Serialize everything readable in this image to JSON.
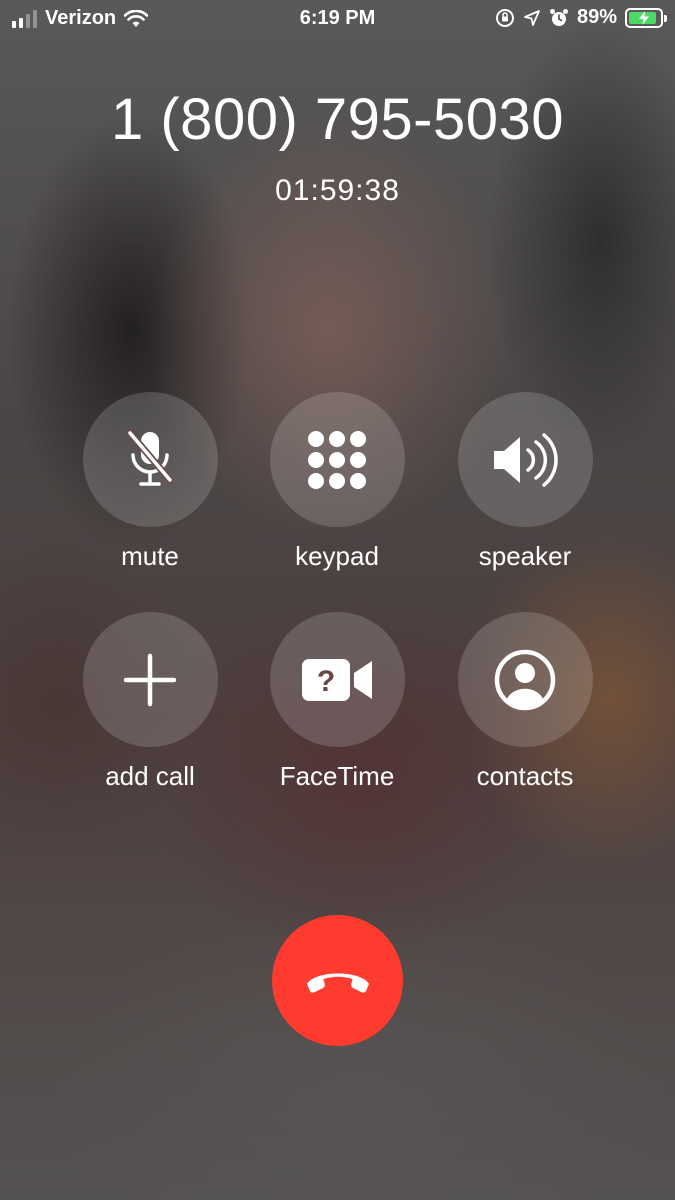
{
  "status_bar": {
    "carrier": "Verizon",
    "time": "6:19 PM",
    "battery_percent": "89%",
    "battery_level": 0.89,
    "icons": [
      "signal-icon",
      "wifi-icon",
      "orientation-lock-icon",
      "location-icon",
      "alarm-icon",
      "battery-icon"
    ]
  },
  "call": {
    "number": "1 (800) 795-5030",
    "duration": "01:59:38"
  },
  "controls": {
    "mute": {
      "label": "mute",
      "icon": "mic-muted-icon"
    },
    "keypad": {
      "label": "keypad",
      "icon": "keypad-icon"
    },
    "speaker": {
      "label": "speaker",
      "icon": "speaker-icon"
    },
    "add_call": {
      "label": "add call",
      "icon": "plus-icon"
    },
    "facetime": {
      "label": "FaceTime",
      "icon": "facetime-unavailable-icon"
    },
    "contacts": {
      "label": "contacts",
      "icon": "contact-icon"
    }
  },
  "end_call": {
    "icon": "end-call-icon"
  },
  "colors": {
    "end_call": "#ff3b30",
    "battery_fill": "#4cd964",
    "button_background": "rgba(255,255,255,0.16)"
  }
}
